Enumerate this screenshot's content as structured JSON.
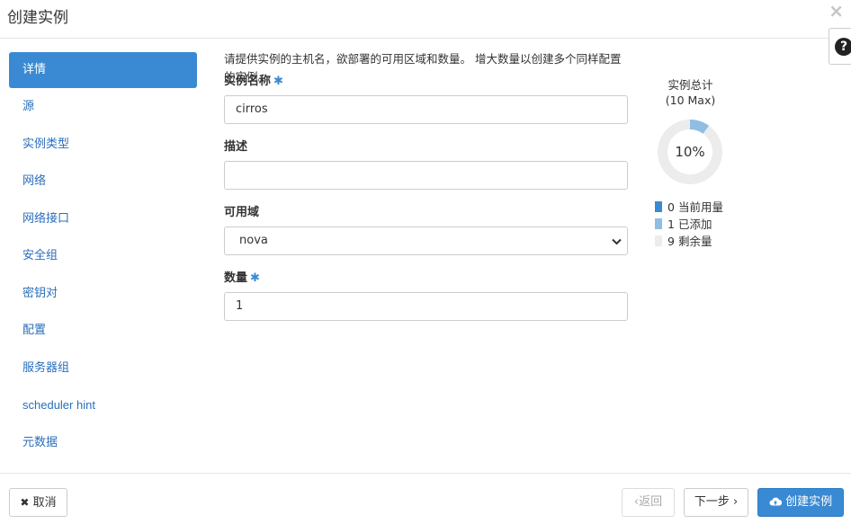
{
  "modal": {
    "title": "创建实例",
    "close_icon": "×",
    "help_icon": "?"
  },
  "sidebar": {
    "items": [
      {
        "label": "详情",
        "active": true
      },
      {
        "label": "源"
      },
      {
        "label": "实例类型"
      },
      {
        "label": "网络"
      },
      {
        "label": "网络接口"
      },
      {
        "label": "安全组"
      },
      {
        "label": "密钥对"
      },
      {
        "label": "配置"
      },
      {
        "label": "服务器组"
      },
      {
        "label": "scheduler hint"
      },
      {
        "label": "元数据"
      }
    ]
  },
  "form": {
    "intro": "请提供实例的主机名，欲部署的可用区域和数量。 增大数量以创建多个同样配置的实例。",
    "required_mark": "✱",
    "instance_name": {
      "label": "实例名称",
      "value": "cirros"
    },
    "description": {
      "label": "描述",
      "value": ""
    },
    "availability_zone": {
      "label": "可用域",
      "value": "nova"
    },
    "count": {
      "label": "数量",
      "value": "1"
    }
  },
  "quota": {
    "title_line1": "实例总计",
    "title_line2": "(10 Max)",
    "percent_label": "10%",
    "used": 0,
    "added": 1,
    "remaining": 9,
    "max": 10,
    "legend": [
      {
        "count": "0",
        "label": "当前用量",
        "color": "#3a8ad3"
      },
      {
        "count": "1",
        "label": "已添加",
        "color": "#91bde4"
      },
      {
        "count": "9",
        "label": "剩余量",
        "color": "#ececec"
      }
    ]
  },
  "footer": {
    "cancel_label": "取消",
    "back_label": "返回",
    "next_label": "下一步",
    "create_label": "创建实例"
  }
}
